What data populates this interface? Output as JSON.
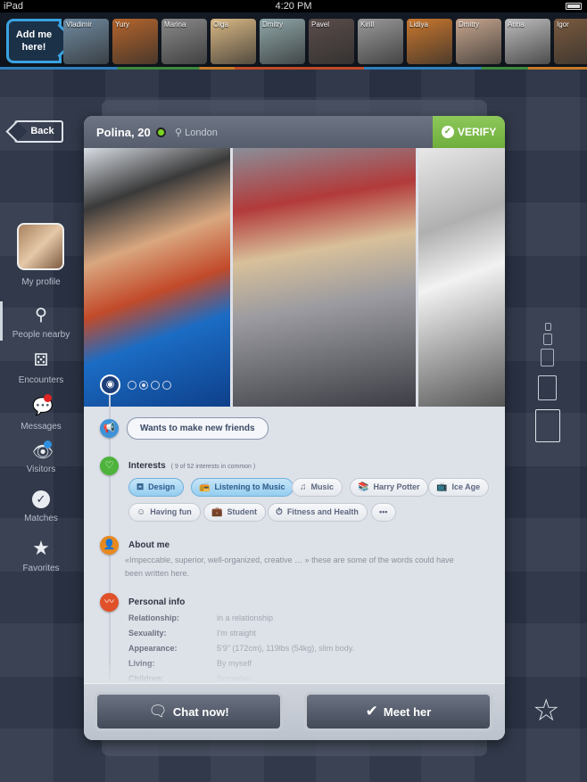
{
  "status_bar": {
    "device": "iPad",
    "time": "4:20 PM"
  },
  "strip": {
    "add_me": "Add me here!",
    "people": [
      {
        "name": "Vladimir",
        "color": "#6f8aa0"
      },
      {
        "name": "Yury",
        "color": "#b5652c"
      },
      {
        "name": "Marina",
        "color": "#8a8a8a"
      },
      {
        "name": "Olga",
        "color": "#d9b884"
      },
      {
        "name": "Dmitry",
        "color": "#8fa6a8"
      },
      {
        "name": "Pavel",
        "color": "#5a4d4a"
      },
      {
        "name": "Kirill",
        "color": "#9a9a9a"
      },
      {
        "name": "Lidiya",
        "color": "#c9772e"
      },
      {
        "name": "Dmitry",
        "color": "#c7a68e"
      },
      {
        "name": "Anna",
        "color": "#bdbdbd"
      },
      {
        "name": "Igor",
        "color": "#7a5a3e"
      }
    ]
  },
  "nav": {
    "back": "Back",
    "items": [
      {
        "label": "My profile",
        "icon": "avatar"
      },
      {
        "label": "People nearby",
        "icon": "map-pin-icon"
      },
      {
        "label": "Encounters",
        "icon": "dice-icon"
      },
      {
        "label": "Messages",
        "icon": "chat-bubble-icon",
        "badge_color": "#e02424"
      },
      {
        "label": "Visitors",
        "icon": "eye-icon",
        "badge_color": "#2f8ee0"
      },
      {
        "label": "Matches",
        "icon": "check-icon"
      },
      {
        "label": "Favorites",
        "icon": "star-icon"
      }
    ]
  },
  "profile": {
    "name": "Polina, 20",
    "online": true,
    "location": "London",
    "verify": "VERIFY",
    "photo_index": 2,
    "photo_count": 4,
    "status": "Wants to make new friends",
    "interests_title": "Interests",
    "interests_common": "( 9 of 52 interests in common )",
    "interests": [
      {
        "label": "Design",
        "icon": "paint-bucket-icon",
        "glyph": "⛾",
        "active": true
      },
      {
        "label": "Listening to Music",
        "icon": "radio-icon",
        "glyph": "📻",
        "active": true
      },
      {
        "label": "Music",
        "icon": "music-note-icon",
        "glyph": "♫",
        "active": false
      },
      {
        "label": "Harry Potter",
        "icon": "books-icon",
        "glyph": "📚",
        "active": false
      },
      {
        "label": "Ice Age",
        "icon": "tv-icon",
        "glyph": "📺",
        "active": false
      },
      {
        "label": "Having fun",
        "icon": "mask-icon",
        "glyph": "☺",
        "active": false
      },
      {
        "label": "Student",
        "icon": "briefcase-icon",
        "glyph": "💼",
        "active": false
      },
      {
        "label": "Fitness and Health",
        "icon": "stopwatch-icon",
        "glyph": "⏱",
        "active": false
      },
      {
        "label": "•••",
        "icon": "more-icon",
        "glyph": "",
        "active": false
      }
    ],
    "about_title": "About me",
    "about": "«Impeccable, superior, well-organized, creative … » these are some of the words could have been written here.",
    "personal_title": "Personal info",
    "personal": [
      {
        "key": "Relationship:",
        "value": "in a relationship"
      },
      {
        "key": "Sexuality:",
        "value": "I'm straight"
      },
      {
        "key": "Appearance:",
        "value": "5'9\" (172cm), 119lbs (54kg), slim body."
      },
      {
        "key": "Living:",
        "value": "By myself"
      },
      {
        "key": "Children:",
        "value": "Someday"
      }
    ]
  },
  "actions": {
    "chat": "Chat now!",
    "meet": "Meet her"
  }
}
